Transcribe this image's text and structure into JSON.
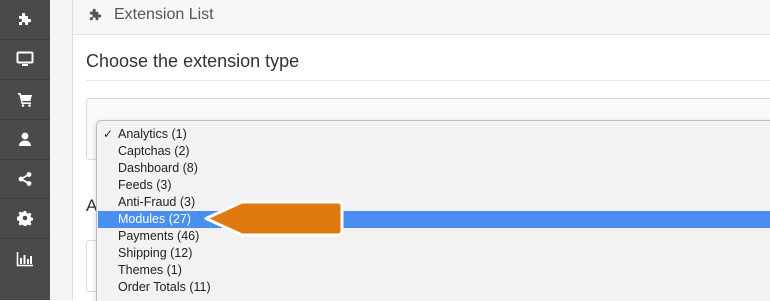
{
  "sidebar": {
    "items": [
      {
        "icon": "puzzle-icon"
      },
      {
        "icon": "monitor-icon"
      },
      {
        "icon": "cart-icon"
      },
      {
        "icon": "user-icon"
      },
      {
        "icon": "share-icon"
      },
      {
        "icon": "gear-icon"
      },
      {
        "icon": "bar-chart-icon"
      }
    ],
    "background": "#4a4a4a"
  },
  "panel": {
    "title": "Extension List",
    "icon": "puzzle-icon"
  },
  "section": {
    "title": "Choose the extension type",
    "next_heading_initial": "A"
  },
  "dropdown": {
    "selected_index": 5,
    "checked_index": 0,
    "highlight_color": "#4a8ff0",
    "options": [
      "Analytics (1)",
      "Captchas (2)",
      "Dashboard (8)",
      "Feeds (3)",
      "Anti-Fraud (3)",
      "Modules (27)",
      "Payments (46)",
      "Shipping (12)",
      "Themes (1)",
      "Order Totals (11)"
    ]
  },
  "callout": {
    "color": "#e07a10",
    "points_to": "Modules (27)"
  }
}
